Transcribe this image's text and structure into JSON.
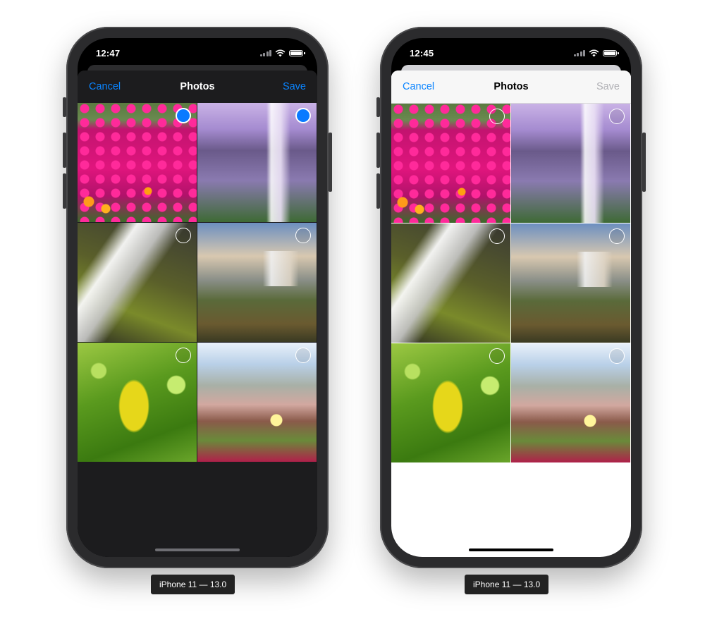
{
  "screens": [
    {
      "theme": "dark",
      "status_time": "12:47",
      "nav": {
        "cancel": "Cancel",
        "title": "Photos",
        "save": "Save"
      },
      "device_label": "iPhone 11 — 13.0",
      "photos": [
        {
          "subject": "pink-flowers",
          "selected": true
        },
        {
          "subject": "purple-waterfall",
          "selected": true
        },
        {
          "subject": "gray-waterfall",
          "selected": false
        },
        {
          "subject": "cliff-waterfall",
          "selected": false
        },
        {
          "subject": "green-leaves",
          "selected": false
        },
        {
          "subject": "ice-plant-flower",
          "selected": false
        }
      ]
    },
    {
      "theme": "light",
      "status_time": "12:45",
      "nav": {
        "cancel": "Cancel",
        "title": "Photos",
        "save": "Save"
      },
      "device_label": "iPhone 11 — 13.0",
      "photos": [
        {
          "subject": "pink-flowers",
          "selected": false
        },
        {
          "subject": "purple-waterfall",
          "selected": false
        },
        {
          "subject": "gray-waterfall",
          "selected": false
        },
        {
          "subject": "cliff-waterfall",
          "selected": false
        },
        {
          "subject": "green-leaves",
          "selected": false
        },
        {
          "subject": "ice-plant-flower",
          "selected": false
        }
      ]
    }
  ],
  "colors": {
    "tint": "#0a84ff",
    "selected_fill": "#0a7aff",
    "save_disabled": "#b0b0b5",
    "dark_sheet": "#1c1c1e"
  },
  "icons": [
    "cellular-signal-icon",
    "wifi-icon",
    "battery-icon",
    "selection-circle-icon"
  ]
}
